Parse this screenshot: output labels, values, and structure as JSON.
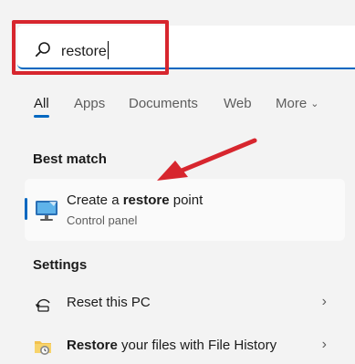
{
  "search": {
    "query": "restore"
  },
  "tabs": [
    {
      "label": "All",
      "active": true
    },
    {
      "label": "Apps"
    },
    {
      "label": "Documents"
    },
    {
      "label": "Web"
    },
    {
      "label": "More"
    }
  ],
  "best_match": {
    "heading": "Best match",
    "title_prefix": "Create a ",
    "title_bold": "restore",
    "title_suffix": " point",
    "subtitle": "Control panel",
    "icon": "computer-icon"
  },
  "settings": {
    "heading": "Settings",
    "items": [
      {
        "label_bold": "",
        "label": "Reset this PC",
        "icon": "reset-icon",
        "chevron": "›"
      },
      {
        "label_bold": "Restore",
        "label": " your files with File History",
        "icon": "folder-history-icon",
        "chevron": "›"
      }
    ]
  },
  "colors": {
    "accent": "#0067c0",
    "annotation_red": "#d7262e",
    "background": "#f3f3f3"
  }
}
